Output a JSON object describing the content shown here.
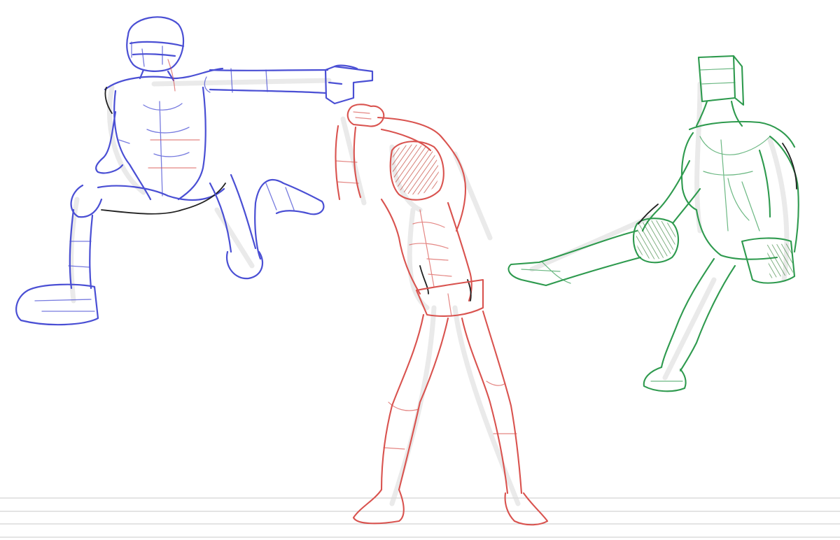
{
  "colors": {
    "background": "#ffffff",
    "blue_sketch": "#4a4fd4",
    "red_sketch": "#d9534f",
    "green_sketch": "#2e9a4e",
    "pencil_dark": "#222222",
    "guide_lines": "#c8c8c8"
  },
  "figures": [
    {
      "name": "blue-figure-leaping-pointing",
      "color": "blue"
    },
    {
      "name": "red-figure-stretching-arms-overhead",
      "color": "red"
    },
    {
      "name": "green-figure-sitting",
      "color": "green"
    }
  ]
}
